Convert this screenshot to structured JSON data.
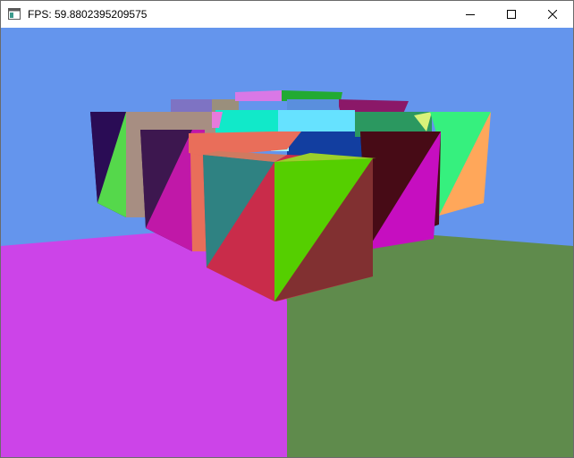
{
  "window": {
    "title": "FPS: 59.8802395209575",
    "buttons": {
      "minimize_icon": "minimize-icon",
      "maximize_icon": "maximize-icon",
      "close_icon": "close-icon"
    }
  },
  "scene": {
    "sky_color": "#6495ed",
    "floor_colors": [
      "#cc44e8",
      "#5f8b4c"
    ],
    "object_count": 16,
    "object_shape": "cube"
  }
}
